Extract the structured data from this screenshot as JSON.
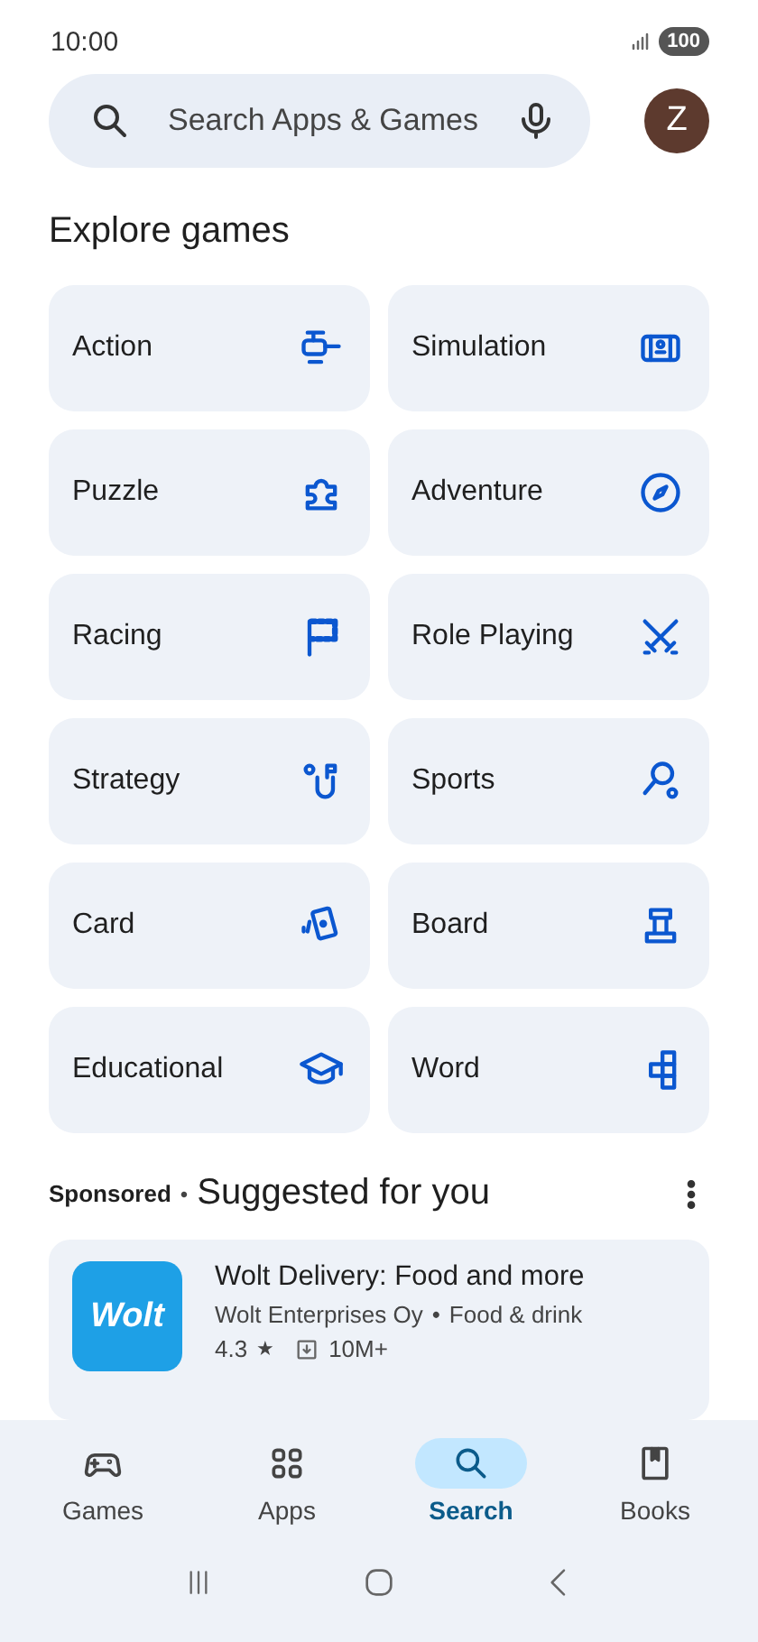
{
  "status_bar": {
    "time": "10:00",
    "battery": "100"
  },
  "search": {
    "placeholder": "Search Apps & Games",
    "avatar": "Z"
  },
  "explore": {
    "title": "Explore games",
    "categories": [
      {
        "label": "Action"
      },
      {
        "label": "Simulation"
      },
      {
        "label": "Puzzle"
      },
      {
        "label": "Adventure"
      },
      {
        "label": "Racing"
      },
      {
        "label": "Role Playing"
      },
      {
        "label": "Strategy"
      },
      {
        "label": "Sports"
      },
      {
        "label": "Card"
      },
      {
        "label": "Board"
      },
      {
        "label": "Educational"
      },
      {
        "label": "Word"
      }
    ]
  },
  "suggested": {
    "sponsored": "Sponsored",
    "separator": "•",
    "title": "Suggested for you",
    "app": {
      "logo": "Wolt",
      "name": "Wolt Delivery: Food and more",
      "developer": "Wolt Enterprises Oy",
      "dot": "•",
      "category": "Food & drink",
      "rating": "4.3",
      "star": "★",
      "downloads": "10M+"
    }
  },
  "nav": [
    {
      "label": "Games",
      "selected": false
    },
    {
      "label": "Apps",
      "selected": false
    },
    {
      "label": "Search",
      "selected": true
    },
    {
      "label": "Books",
      "selected": false
    }
  ]
}
